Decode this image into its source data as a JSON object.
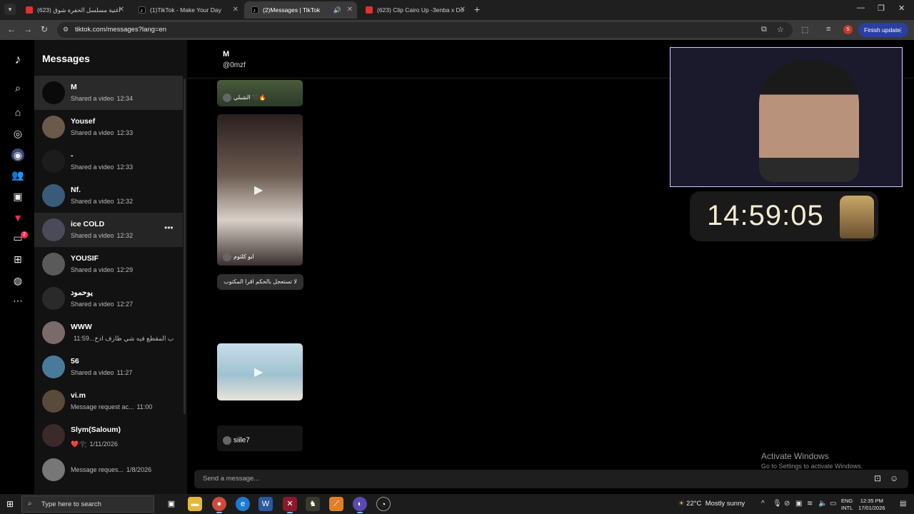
{
  "browser": {
    "tabs": [
      {
        "title": "اغنية مسلسل الحفرة شوق (623)",
        "favicon": "youtube-icon",
        "active": false
      },
      {
        "title": "(1)TikTok - Make Your Day",
        "favicon": "tiktok-icon",
        "active": false
      },
      {
        "title": "(2)Messages | TikTok",
        "favicon": "tiktok-icon",
        "active": true
      },
      {
        "title": "(623) Clip Cairo Up -3enba x Do",
        "favicon": "youtube-icon",
        "active": false
      }
    ],
    "url": "tiktok.com/messages?lang=en",
    "profile_letter": "S",
    "finish_update": "Finish update"
  },
  "sidebar_rail": {
    "messages_badge": "2"
  },
  "messages": {
    "title": "Messages",
    "conversations": [
      {
        "name": "M",
        "preview": "Shared a video",
        "time": "12:34",
        "avatar": "#0a0a0a"
      },
      {
        "name": "Yousef",
        "preview": "Shared a video",
        "time": "12:33",
        "avatar": "#6b5a4a"
      },
      {
        "name": "-",
        "preview": "Shared a video",
        "time": "12:33",
        "avatar": "#1c1c1c"
      },
      {
        "name": "Nf.",
        "preview": "Shared a video",
        "time": "12:32",
        "avatar": "#3a5a7a"
      },
      {
        "name": "ice COLD",
        "preview": "Shared a video",
        "time": "12:32",
        "avatar": "#4a4a5a"
      },
      {
        "name": "YOUSIF",
        "preview": "Shared a video",
        "time": "12:29",
        "avatar": "#5a5a5a"
      },
      {
        "name": "يوحمود",
        "preview": "Shared a video",
        "time": "12:27",
        "avatar": "#2a2a2a"
      },
      {
        "name": "WWW",
        "preview": "ب المقطع فيه شي ظارف ادخ...",
        "time": "11:59",
        "avatar": "#7a6a6a"
      },
      {
        "name": "56",
        "preview": "Shared a video",
        "time": "11:27",
        "avatar": "#4a7a9a"
      },
      {
        "name": "vi.m",
        "preview": "Message request ac...",
        "time": "11:00",
        "avatar": "#5a4a3a"
      },
      {
        "name": "Slym(Saloum)",
        "preview": "❤️𓂀",
        "time": "1/11/2026",
        "avatar": "#3a2a2a"
      },
      {
        "name": "",
        "preview": "Message reques...",
        "time": "1/8/2026",
        "avatar": "#777777"
      }
    ]
  },
  "chat": {
    "name": "M",
    "handle": "@0mzf",
    "cards": [
      {
        "author": "الشبلي 🖤🔥"
      },
      {
        "author": "ابو كلثوم"
      },
      {
        "author": ""
      },
      {
        "author": "siile7"
      }
    ],
    "caption": "لا تستعجل بالحكم اقرا المكتوب",
    "composer_placeholder": "Send a message..."
  },
  "overlay": {
    "timer": "14:59:05",
    "activate_title": "Activate Windows",
    "activate_sub": "Go to Settings to activate Windows."
  },
  "taskbar": {
    "search_placeholder": "Type here to search",
    "temperature": "22°C",
    "weather": "Mostly sunny",
    "lang_line1": "ENG",
    "lang_line2": "INTL",
    "time": "12:35 PM",
    "date": "17/01/2026"
  }
}
